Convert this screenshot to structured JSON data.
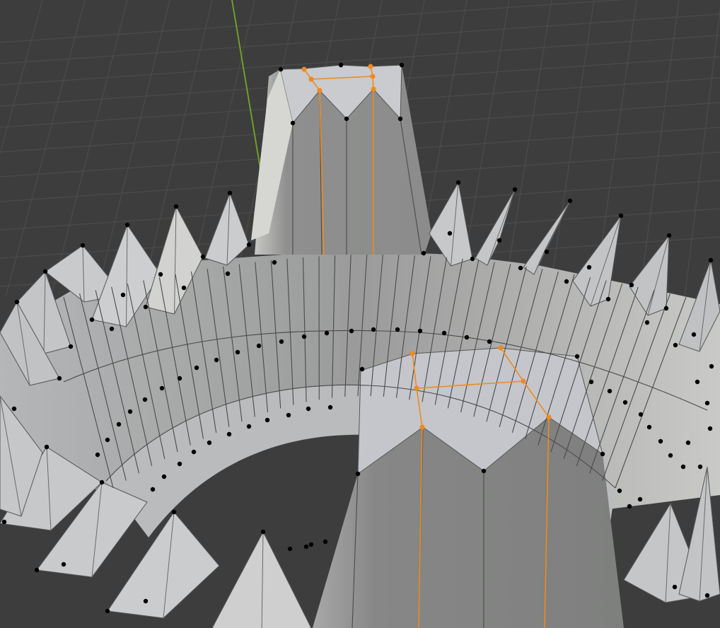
{
  "viewport": {
    "mode": "edit-mode",
    "view": "perspective"
  },
  "scene": {
    "background_color": "#3d3d3d",
    "grid_line_color": "#4b4b4b",
    "y_axis_color": "#6f9e2b",
    "face_light_color": "#d8d8d6",
    "face_mid_color": "#bfc1c4",
    "face_shadow_color": "#8a8b8a",
    "vertex_color": "#000000",
    "selected_color": "#f08a1e"
  },
  "selection": {
    "selected_vertex_count": 12,
    "selected_edge_loops": 2
  }
}
